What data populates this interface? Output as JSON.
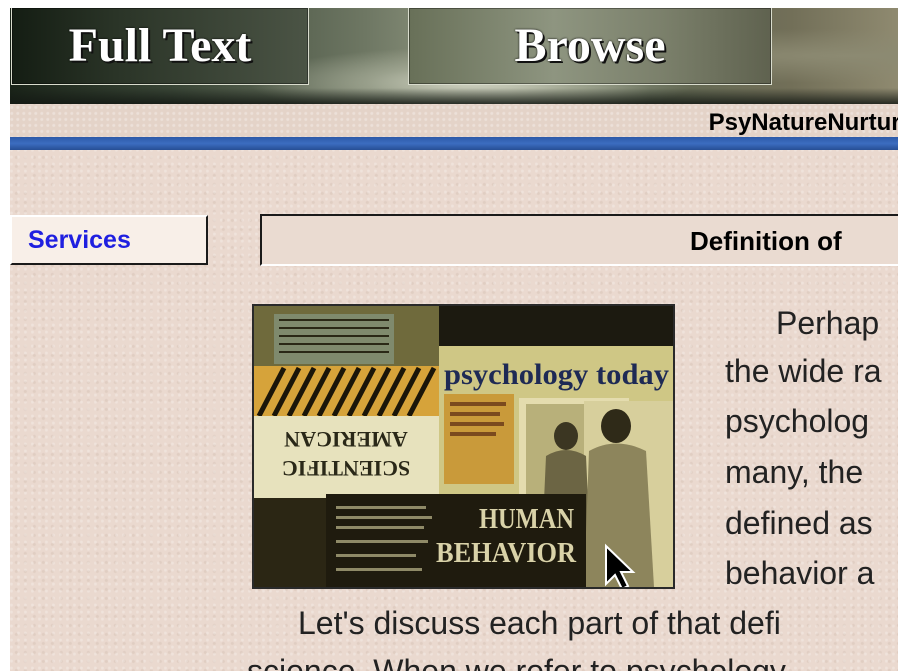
{
  "nav": {
    "full_text": "Full Text",
    "browse": "Browse"
  },
  "site_title": "PsyNatureNurture D",
  "sidebar": {
    "services": "Services"
  },
  "section": {
    "heading": "Definition of"
  },
  "illustration": {
    "magazine_title": "psychology today",
    "cover_line_1": "SCIENTIFIC",
    "cover_line_2": "AMERICAN",
    "book_line_1": "HUMAN",
    "book_line_2": "BEHAVIOR",
    "icon": "mouse-cursor-icon"
  },
  "body": {
    "lines": [
      "Perhap",
      "the wide ra",
      "psycholog",
      "many, the",
      "defined as",
      "behavior a",
      "Let's discuss each part of that defi",
      "science. When we refer to psychology"
    ]
  },
  "colors": {
    "background": "#ead9cf",
    "link_blue": "#1f1fe0",
    "rule_blue": "#2d5aa8"
  }
}
